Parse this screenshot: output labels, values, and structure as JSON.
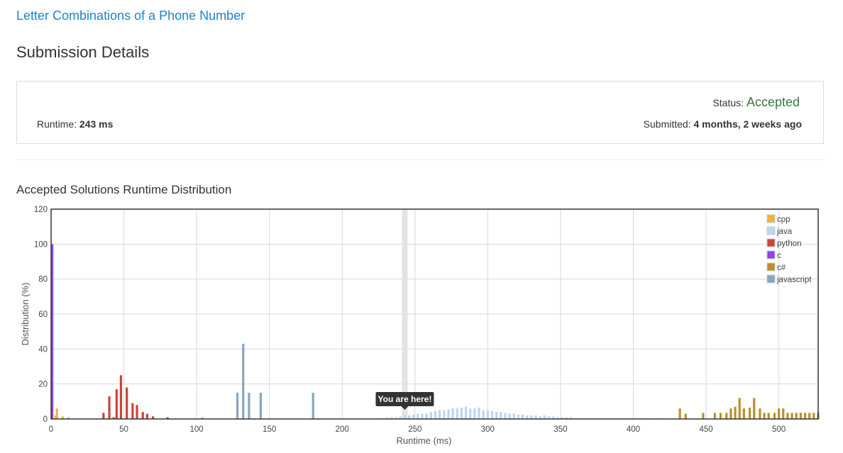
{
  "problem": {
    "title": "Letter Combinations of a Phone Number"
  },
  "page": {
    "title": "Submission Details"
  },
  "details": {
    "status_label": "Status:",
    "status_value": "Accepted",
    "runtime_label": "Runtime:",
    "runtime_value": "243 ms",
    "submitted_label": "Submitted:",
    "submitted_value": "4 months, 2 weeks ago"
  },
  "distribution": {
    "title": "Accepted Solutions Runtime Distribution"
  },
  "colors": {
    "cpp": "#e8b63c",
    "java": "#b9d6f2",
    "python": "#c9443c",
    "c": "#8e44ec",
    "csharp": "#b8902e",
    "javascript": "#8aa5bd",
    "status": "#3c763d",
    "link": "#1a85c7"
  },
  "chart_data": {
    "type": "bar",
    "xlabel": "Runtime (ms)",
    "ylabel": "Distribution (%)",
    "xlim": [
      0,
      527
    ],
    "ylim": [
      0,
      120
    ],
    "xticks": [
      0,
      50,
      100,
      150,
      200,
      250,
      300,
      350,
      400,
      450,
      500
    ],
    "yticks": [
      0,
      20,
      40,
      60,
      80,
      100,
      120
    ],
    "grid": true,
    "legend": "top-right",
    "marker": {
      "x": 243,
      "label": "You are here!"
    },
    "series": [
      {
        "name": "cpp",
        "color": "#e8b63c",
        "x": [
          3,
          4,
          8,
          12,
          104
        ],
        "values": [
          2,
          6,
          1.5,
          1,
          1
        ]
      },
      {
        "name": "java",
        "color": "#b9d6f2",
        "x": [
          225,
          228,
          231,
          234,
          237,
          240,
          243,
          246,
          249,
          252,
          255,
          258,
          261,
          264,
          267,
          270,
          273,
          276,
          279,
          282,
          285,
          288,
          291,
          294,
          297,
          300,
          303,
          306,
          309,
          312,
          315,
          318,
          321,
          324,
          327,
          330,
          333,
          336,
          339,
          342,
          345,
          348,
          351,
          354,
          357,
          360,
          365,
          370,
          375,
          380,
          385,
          390,
          395,
          400,
          410,
          420
        ],
        "values": [
          0.5,
          0.5,
          1,
          1,
          1,
          1.5,
          2,
          2,
          2.5,
          3,
          3,
          3,
          4,
          4.5,
          5,
          5,
          5.5,
          6,
          6,
          6.5,
          7,
          6,
          6,
          6.5,
          5,
          5,
          4.5,
          4,
          4,
          3.5,
          3,
          3,
          2.5,
          2.5,
          2,
          2,
          2,
          1.5,
          2,
          1.5,
          1.5,
          1,
          1,
          1,
          1,
          0.5,
          0.5,
          0.5,
          0.5,
          0.5,
          0.5,
          0.5,
          0.5,
          0.5,
          0.5,
          0.5
        ]
      },
      {
        "name": "python",
        "color": "#c9443c",
        "x": [
          36,
          40,
          43,
          45,
          48,
          52,
          56,
          59,
          63,
          66,
          70,
          80
        ],
        "values": [
          3.5,
          13,
          1,
          17,
          25,
          18,
          9,
          8,
          4,
          3,
          1.5,
          1
        ]
      },
      {
        "name": "c",
        "color": "#8e44ec",
        "x": [
          0
        ],
        "values": [
          100
        ]
      },
      {
        "name": "c#",
        "color": "#b8902e",
        "x": [
          432,
          436,
          448,
          456,
          460,
          464,
          467,
          470,
          473,
          476,
          480,
          483,
          487,
          490,
          493,
          497,
          500,
          503,
          506,
          509,
          512,
          515,
          518,
          521,
          524,
          527
        ],
        "values": [
          6,
          3,
          3.5,
          3.5,
          3.5,
          3.5,
          6,
          7,
          12,
          6,
          6.5,
          12,
          6,
          3.5,
          3.5,
          3.5,
          6,
          6,
          3.5,
          3.5,
          3.5,
          3.5,
          3.5,
          3.5,
          3.5,
          3.5
        ]
      },
      {
        "name": "javascript",
        "color": "#8aa5bd",
        "x": [
          128,
          132,
          136,
          144,
          180
        ],
        "values": [
          15,
          43,
          15,
          15,
          15
        ]
      }
    ]
  }
}
